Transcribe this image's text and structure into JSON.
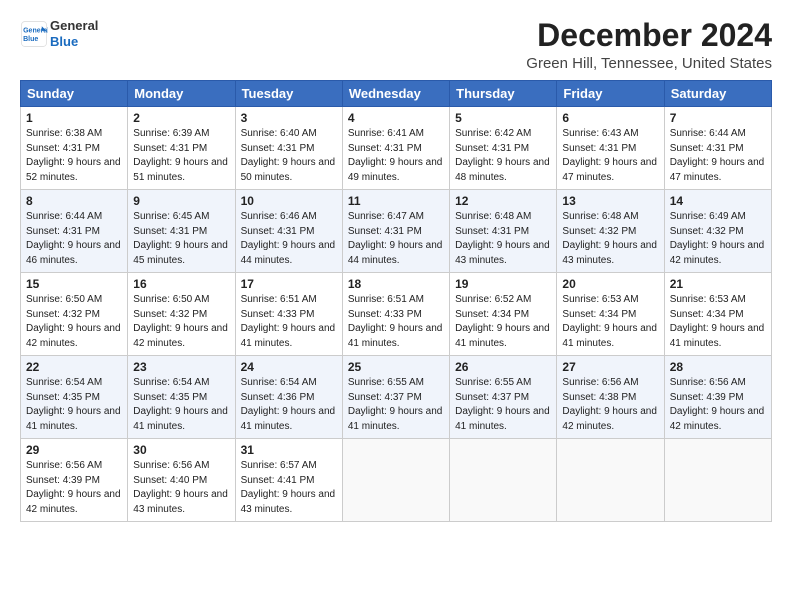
{
  "logo": {
    "line1": "General",
    "line2": "Blue"
  },
  "title": "December 2024",
  "subtitle": "Green Hill, Tennessee, United States",
  "weekdays": [
    "Sunday",
    "Monday",
    "Tuesday",
    "Wednesday",
    "Thursday",
    "Friday",
    "Saturday"
  ],
  "weeks": [
    [
      {
        "day": "1",
        "sunrise": "Sunrise: 6:38 AM",
        "sunset": "Sunset: 4:31 PM",
        "daylight": "Daylight: 9 hours and 52 minutes."
      },
      {
        "day": "2",
        "sunrise": "Sunrise: 6:39 AM",
        "sunset": "Sunset: 4:31 PM",
        "daylight": "Daylight: 9 hours and 51 minutes."
      },
      {
        "day": "3",
        "sunrise": "Sunrise: 6:40 AM",
        "sunset": "Sunset: 4:31 PM",
        "daylight": "Daylight: 9 hours and 50 minutes."
      },
      {
        "day": "4",
        "sunrise": "Sunrise: 6:41 AM",
        "sunset": "Sunset: 4:31 PM",
        "daylight": "Daylight: 9 hours and 49 minutes."
      },
      {
        "day": "5",
        "sunrise": "Sunrise: 6:42 AM",
        "sunset": "Sunset: 4:31 PM",
        "daylight": "Daylight: 9 hours and 48 minutes."
      },
      {
        "day": "6",
        "sunrise": "Sunrise: 6:43 AM",
        "sunset": "Sunset: 4:31 PM",
        "daylight": "Daylight: 9 hours and 47 minutes."
      },
      {
        "day": "7",
        "sunrise": "Sunrise: 6:44 AM",
        "sunset": "Sunset: 4:31 PM",
        "daylight": "Daylight: 9 hours and 47 minutes."
      }
    ],
    [
      {
        "day": "8",
        "sunrise": "Sunrise: 6:44 AM",
        "sunset": "Sunset: 4:31 PM",
        "daylight": "Daylight: 9 hours and 46 minutes."
      },
      {
        "day": "9",
        "sunrise": "Sunrise: 6:45 AM",
        "sunset": "Sunset: 4:31 PM",
        "daylight": "Daylight: 9 hours and 45 minutes."
      },
      {
        "day": "10",
        "sunrise": "Sunrise: 6:46 AM",
        "sunset": "Sunset: 4:31 PM",
        "daylight": "Daylight: 9 hours and 44 minutes."
      },
      {
        "day": "11",
        "sunrise": "Sunrise: 6:47 AM",
        "sunset": "Sunset: 4:31 PM",
        "daylight": "Daylight: 9 hours and 44 minutes."
      },
      {
        "day": "12",
        "sunrise": "Sunrise: 6:48 AM",
        "sunset": "Sunset: 4:31 PM",
        "daylight": "Daylight: 9 hours and 43 minutes."
      },
      {
        "day": "13",
        "sunrise": "Sunrise: 6:48 AM",
        "sunset": "Sunset: 4:32 PM",
        "daylight": "Daylight: 9 hours and 43 minutes."
      },
      {
        "day": "14",
        "sunrise": "Sunrise: 6:49 AM",
        "sunset": "Sunset: 4:32 PM",
        "daylight": "Daylight: 9 hours and 42 minutes."
      }
    ],
    [
      {
        "day": "15",
        "sunrise": "Sunrise: 6:50 AM",
        "sunset": "Sunset: 4:32 PM",
        "daylight": "Daylight: 9 hours and 42 minutes."
      },
      {
        "day": "16",
        "sunrise": "Sunrise: 6:50 AM",
        "sunset": "Sunset: 4:32 PM",
        "daylight": "Daylight: 9 hours and 42 minutes."
      },
      {
        "day": "17",
        "sunrise": "Sunrise: 6:51 AM",
        "sunset": "Sunset: 4:33 PM",
        "daylight": "Daylight: 9 hours and 41 minutes."
      },
      {
        "day": "18",
        "sunrise": "Sunrise: 6:51 AM",
        "sunset": "Sunset: 4:33 PM",
        "daylight": "Daylight: 9 hours and 41 minutes."
      },
      {
        "day": "19",
        "sunrise": "Sunrise: 6:52 AM",
        "sunset": "Sunset: 4:34 PM",
        "daylight": "Daylight: 9 hours and 41 minutes."
      },
      {
        "day": "20",
        "sunrise": "Sunrise: 6:53 AM",
        "sunset": "Sunset: 4:34 PM",
        "daylight": "Daylight: 9 hours and 41 minutes."
      },
      {
        "day": "21",
        "sunrise": "Sunrise: 6:53 AM",
        "sunset": "Sunset: 4:34 PM",
        "daylight": "Daylight: 9 hours and 41 minutes."
      }
    ],
    [
      {
        "day": "22",
        "sunrise": "Sunrise: 6:54 AM",
        "sunset": "Sunset: 4:35 PM",
        "daylight": "Daylight: 9 hours and 41 minutes."
      },
      {
        "day": "23",
        "sunrise": "Sunrise: 6:54 AM",
        "sunset": "Sunset: 4:35 PM",
        "daylight": "Daylight: 9 hours and 41 minutes."
      },
      {
        "day": "24",
        "sunrise": "Sunrise: 6:54 AM",
        "sunset": "Sunset: 4:36 PM",
        "daylight": "Daylight: 9 hours and 41 minutes."
      },
      {
        "day": "25",
        "sunrise": "Sunrise: 6:55 AM",
        "sunset": "Sunset: 4:37 PM",
        "daylight": "Daylight: 9 hours and 41 minutes."
      },
      {
        "day": "26",
        "sunrise": "Sunrise: 6:55 AM",
        "sunset": "Sunset: 4:37 PM",
        "daylight": "Daylight: 9 hours and 41 minutes."
      },
      {
        "day": "27",
        "sunrise": "Sunrise: 6:56 AM",
        "sunset": "Sunset: 4:38 PM",
        "daylight": "Daylight: 9 hours and 42 minutes."
      },
      {
        "day": "28",
        "sunrise": "Sunrise: 6:56 AM",
        "sunset": "Sunset: 4:39 PM",
        "daylight": "Daylight: 9 hours and 42 minutes."
      }
    ],
    [
      {
        "day": "29",
        "sunrise": "Sunrise: 6:56 AM",
        "sunset": "Sunset: 4:39 PM",
        "daylight": "Daylight: 9 hours and 42 minutes."
      },
      {
        "day": "30",
        "sunrise": "Sunrise: 6:56 AM",
        "sunset": "Sunset: 4:40 PM",
        "daylight": "Daylight: 9 hours and 43 minutes."
      },
      {
        "day": "31",
        "sunrise": "Sunrise: 6:57 AM",
        "sunset": "Sunset: 4:41 PM",
        "daylight": "Daylight: 9 hours and 43 minutes."
      },
      null,
      null,
      null,
      null
    ]
  ]
}
